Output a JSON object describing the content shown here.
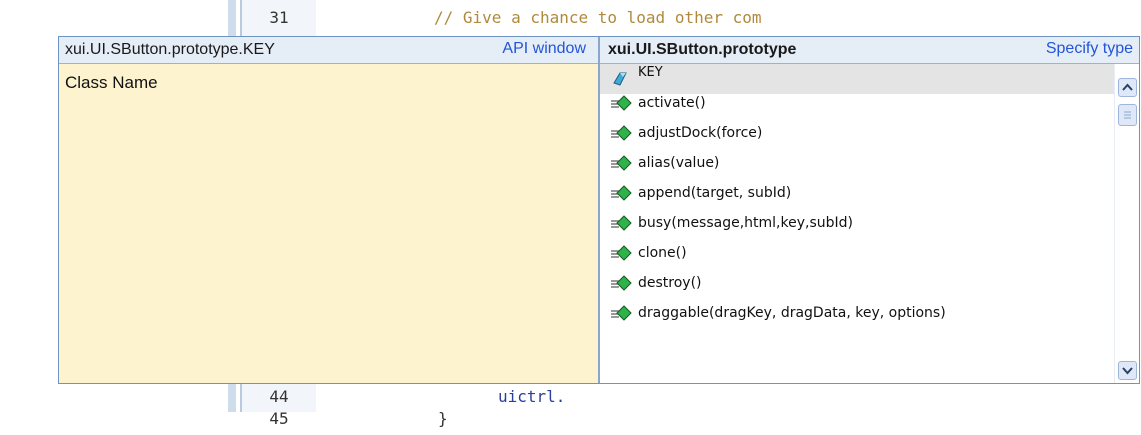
{
  "editor": {
    "lines": [
      {
        "num": "31",
        "code": "// Give a chance to load other com",
        "kind": "comment"
      },
      {
        "num": "44",
        "code": "uictrl.",
        "kind": "ident"
      },
      {
        "num": "45",
        "code": "}",
        "kind": "brace"
      }
    ]
  },
  "api_popup": {
    "left_header": {
      "title": "xui.UI.SButton.prototype.KEY",
      "link": "API window"
    },
    "class_label": "Class Name",
    "right_header": {
      "title": "xui.UI.SButton.prototype",
      "link": "Specify type"
    },
    "members": [
      {
        "label": "KEY",
        "icon": "property-icon",
        "selected": true
      },
      {
        "label": "activate()",
        "icon": "method-icon",
        "selected": false
      },
      {
        "label": "adjustDock(force)",
        "icon": "method-icon",
        "selected": false
      },
      {
        "label": "alias(value)",
        "icon": "method-icon",
        "selected": false
      },
      {
        "label": "append(target, subId)",
        "icon": "method-icon",
        "selected": false
      },
      {
        "label": "busy(message,html,key,subId)",
        "icon": "method-icon",
        "selected": false
      },
      {
        "label": "clone()",
        "icon": "method-icon",
        "selected": false
      },
      {
        "label": "destroy()",
        "icon": "method-icon",
        "selected": false
      },
      {
        "label": "draggable(dragKey, dragData, key, options)",
        "icon": "method-icon",
        "selected": false
      }
    ]
  },
  "colors": {
    "popup_left_bg": "#fdf3cf",
    "header_bg": "#e5edf7",
    "link": "#2255d8",
    "comment": "#b08a3c",
    "identifier": "#2a3f9d"
  }
}
